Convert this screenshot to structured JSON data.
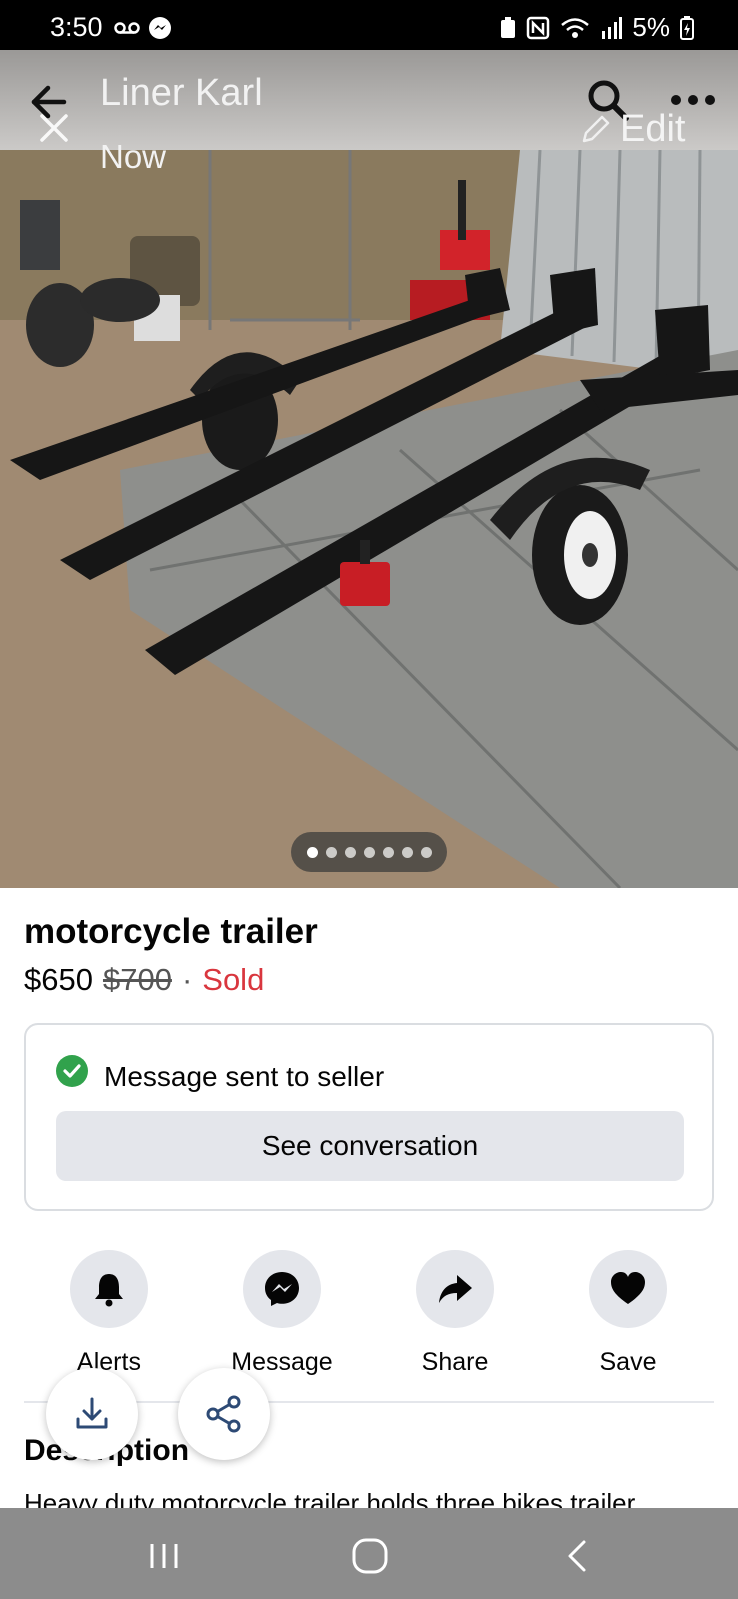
{
  "status_bar": {
    "time": "3:50",
    "battery": "5%",
    "icons": [
      "voicemail-icon",
      "messenger-icon",
      "nfc-icon",
      "wifi-icon",
      "signal-icon",
      "battery-charging-icon"
    ]
  },
  "header": {
    "seller_name": "Liner Karl",
    "posted_time": "Now",
    "edit_label": "Edit",
    "icons": [
      "back-arrow-icon",
      "close-icon",
      "search-icon",
      "more-icon",
      "pencil-icon"
    ]
  },
  "gallery": {
    "photo_count": 7,
    "active_index": 0
  },
  "listing": {
    "title": "motorcycle trailer",
    "price": "$650",
    "original_price": "$700",
    "separator": "·",
    "status": "Sold"
  },
  "message_card": {
    "confirmation": "Message sent to seller",
    "button_label": "See conversation"
  },
  "actions": [
    {
      "label": "Alerts",
      "icon": "bell-icon"
    },
    {
      "label": "Message",
      "icon": "messenger-icon"
    },
    {
      "label": "Share",
      "icon": "share-arrow-icon"
    },
    {
      "label": "Save",
      "icon": "heart-icon"
    }
  ],
  "description": {
    "heading": "Description",
    "text": "Heavy duty motorcycle trailer holds three bikes trailer"
  },
  "colors": {
    "accent_green": "#31a24c",
    "sold_red": "#d9363e",
    "button_gray": "#e4e6eb",
    "nav_gray": "#8c8c8c"
  }
}
